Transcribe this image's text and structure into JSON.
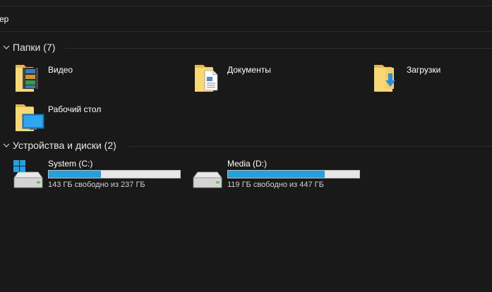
{
  "address": {
    "text": "ер"
  },
  "groups": [
    {
      "title": "Папки (7)"
    },
    {
      "title": "Устройства и диски (2)"
    }
  ],
  "folders": [
    {
      "label": "Видео",
      "icon": "video-folder-icon"
    },
    {
      "label": "Документы",
      "icon": "documents-folder-icon"
    },
    {
      "label": "Загрузки",
      "icon": "downloads-folder-icon"
    },
    {
      "label": "Рабочий стол",
      "icon": "desktop-folder-icon"
    }
  ],
  "drives": [
    {
      "name": "System (C:)",
      "free_text": "143 ГБ свободно из 237 ГБ",
      "used_fraction": 0.397,
      "icon": "system-drive-icon"
    },
    {
      "name": "Media (D:)",
      "free_text": "119 ГБ свободно из 447 ГБ",
      "used_fraction": 0.734,
      "icon": "drive-icon"
    }
  ],
  "colors": {
    "background": "#191919",
    "bar_fill": "#26a0da",
    "bar_track": "#e6e6e6",
    "folder": "#f8d775"
  }
}
